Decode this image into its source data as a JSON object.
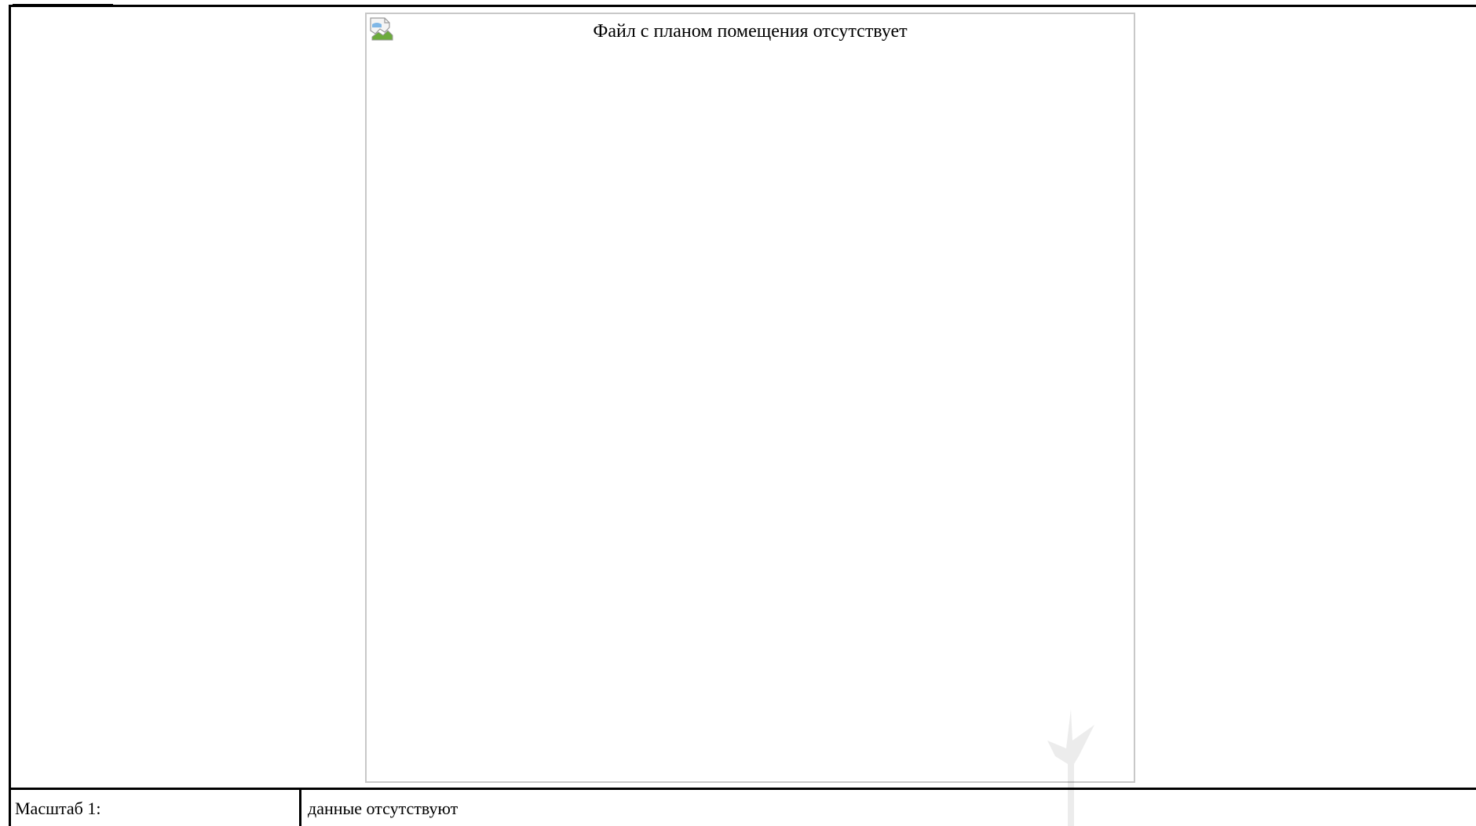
{
  "document": {
    "plan_alt_text": "Файл с планом помещения отсутствует",
    "scale_label": "Масштаб 1:",
    "scale_value": "данные отсутствуют"
  }
}
